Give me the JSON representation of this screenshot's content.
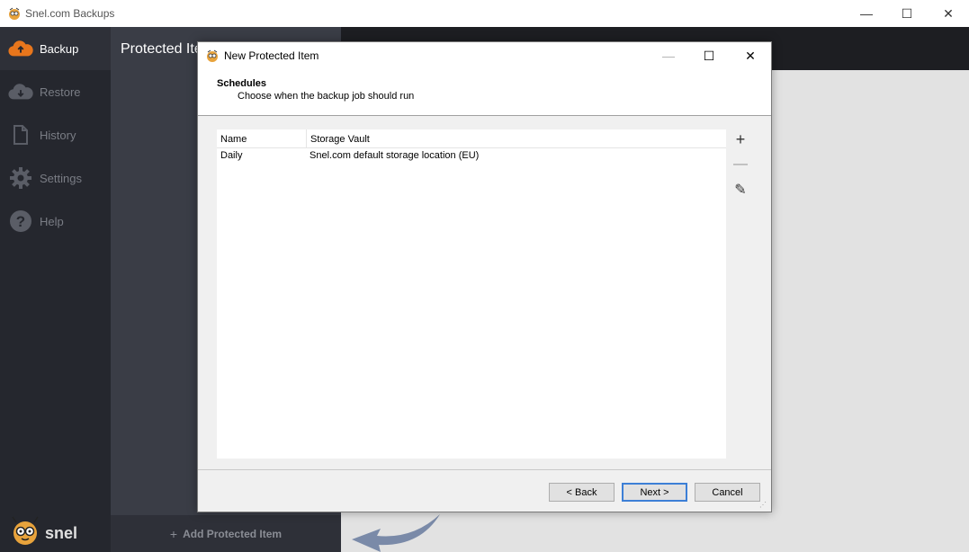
{
  "app": {
    "title": "Snel.com Backups",
    "window_controls": {
      "minimize": "—",
      "maximize": "☐",
      "close": "✕"
    }
  },
  "sidebar": {
    "items": [
      {
        "label": "Backup",
        "icon": "cloud-upload-icon",
        "active": true
      },
      {
        "label": "Restore",
        "icon": "cloud-download-icon",
        "active": false
      },
      {
        "label": "History",
        "icon": "document-icon",
        "active": false
      },
      {
        "label": "Settings",
        "icon": "gear-icon",
        "active": false
      },
      {
        "label": "Help",
        "icon": "question-icon",
        "active": false
      }
    ],
    "logo_text": "snel"
  },
  "middle_panel": {
    "title": "Protected Item",
    "add_button_label": "Add Protected Item",
    "add_icon": "+"
  },
  "dialog": {
    "title": "New Protected Item",
    "controls": {
      "minimize": "—",
      "maximize": "☐",
      "close": "✕"
    },
    "heading": "Schedules",
    "subheading": "Choose when the backup job should run",
    "list": {
      "columns": [
        "Name",
        "Storage Vault"
      ],
      "rows": [
        {
          "name": "Daily",
          "vault": "Snel.com default storage location (EU)"
        }
      ]
    },
    "tools": {
      "add": "+",
      "remove": "—",
      "edit": "✎"
    },
    "buttons": {
      "back": "< Back",
      "next": "Next >",
      "cancel": "Cancel"
    }
  },
  "colors": {
    "sidebar_bg": "#25272e",
    "middle_bg": "#3a3d46",
    "accent_orange": "#e8761c",
    "next_button_border": "#3c7fd6"
  }
}
